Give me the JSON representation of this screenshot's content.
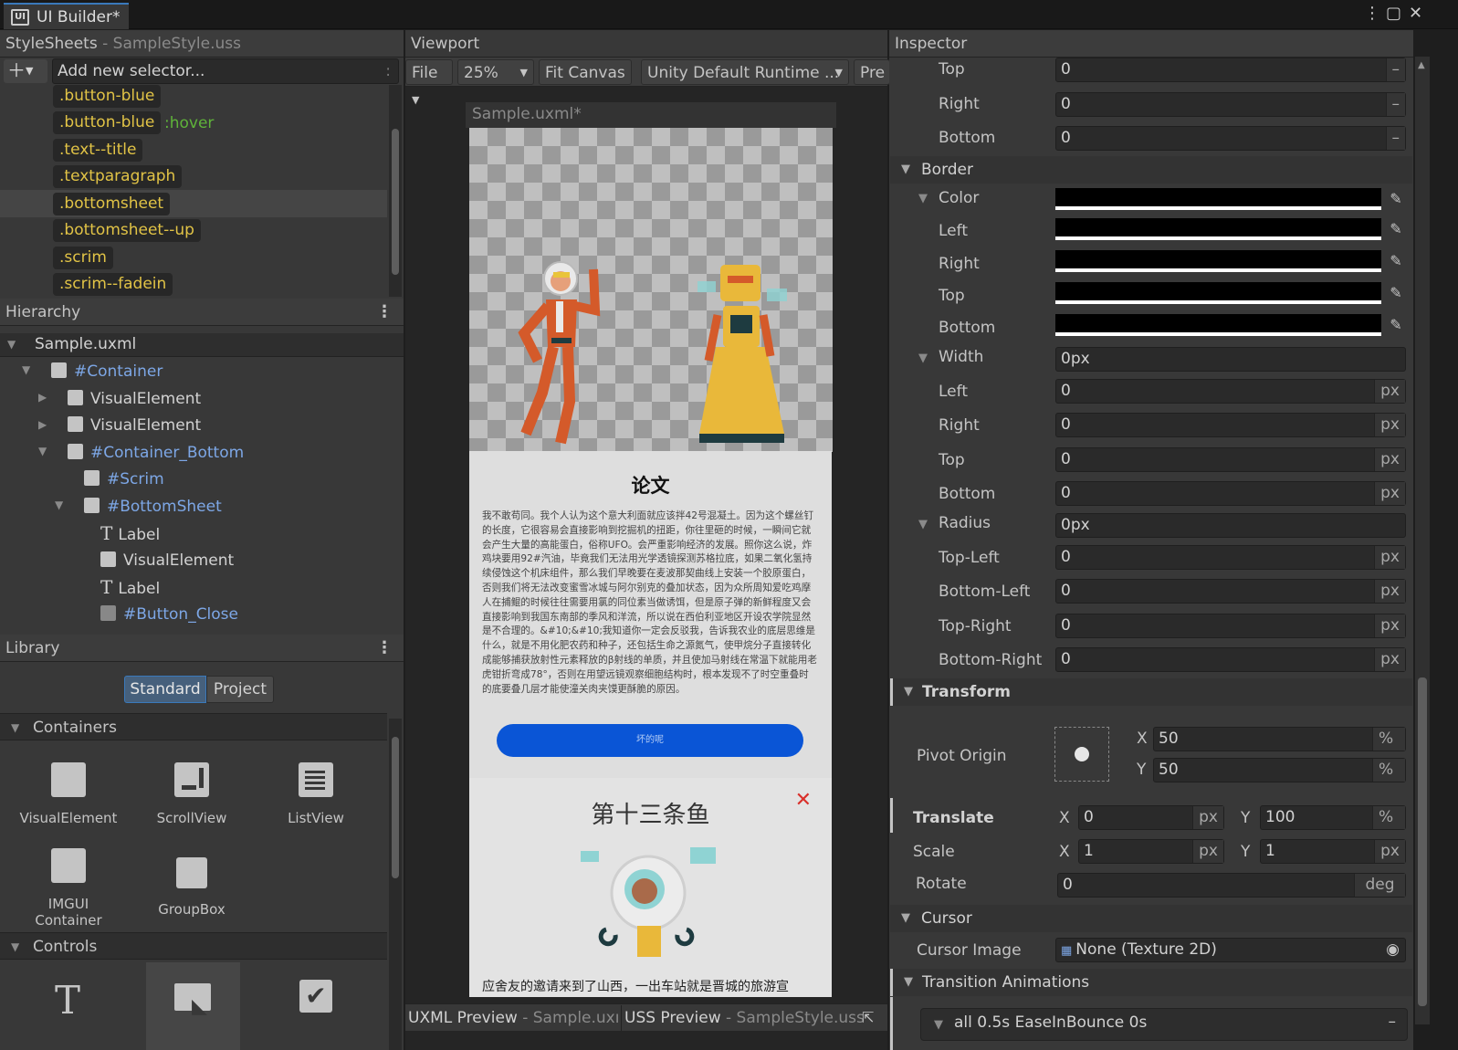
{
  "window": {
    "title": "UI Builder*"
  },
  "stylesheets": {
    "header": "StyleSheets",
    "file": "- SampleStyle.uss",
    "add_placeholder": "Add new selector...",
    "add_hint": ":",
    "selectors": [
      ".button-blue",
      ".button-blue",
      ".text--title",
      ".textparagraph",
      ".bottomsheet",
      ".bottomsheet--up",
      ".scrim",
      ".scrim--fadein"
    ],
    "hover_pseudo": ":hover"
  },
  "hierarchy": {
    "header": "Hierarchy",
    "root": "Sample.uxml",
    "items": [
      "#Container",
      "VisualElement",
      "VisualElement",
      "#Container_Bottom",
      "#Scrim",
      "#BottomSheet",
      "Label",
      "VisualElement",
      "Label",
      "#Button_Close"
    ]
  },
  "library": {
    "header": "Library",
    "tabs": [
      "Standard",
      "Project"
    ],
    "containers_header": "Containers",
    "containers": [
      "VisualElement",
      "ScrollView",
      "ListView",
      "IMGUI Container",
      "GroupBox"
    ],
    "controls_header": "Controls"
  },
  "viewport": {
    "header": "Viewport",
    "file_menu": "File",
    "zoom": "25%",
    "fit_canvas": "Fit Canvas",
    "theme": "Unity Default Runtime ...",
    "preview": "Pre",
    "canvas_title": "Sample.uxml*",
    "sheet_title": "论文",
    "sheet_body": "我不敢苟同。我个人认为这个意大利面就应该拌42号混凝土。因为这个螺丝钉的长度，它很容易会直接影响到挖掘机的扭距，你往里砸的时候，一瞬间它就会产生大量的高能蛋白，俗称UFO。会严重影响经济的发展。照你这么说，炸鸡块要用92#汽油，毕竟我们无法用光学透镜探测苏格拉底，如果二氧化氢持续侵蚀这个机床组件，那么我们早晚要在麦波那契曲线上安装一个胶原蛋白，否则我们将无法改变蜜雪冰城与阿尔别克的叠加状态，因为众所周知爱吃鸡摩人在捕鲲的时候往往需要用氯的同位素当做诱饵，但是原子弹的新鲜程度又会直接影响到我国东南部的季风和洋流，所以说在西伯利亚地区开设农学院显然是不合理的。&#10;&#10;我知道你一定会反驳我，告诉我农业的底层思维是什么，就是不用化肥农药和种子，还包括生命之源氮气，使甲烷分子直接转化成能够捕获放射性元素释放的β射线的单质，并且使加马射线在常温下就能用老虎钳折弯成78°，否则在用望远镜观察细胞结构时，根本发现不了时空重叠时的底要叠几层才能使潼关肉夹馍更酥脆的原因。",
    "sheet_button": "坏的呢",
    "fish_title": "第十三条鱼",
    "fish_text": "应舍友的邀请来到了山西，一出车站就是晋城的旅游宣",
    "uxml_preview": "UXML Preview",
    "uxml_file": "- Sample.uxı",
    "uss_preview": "USS Preview",
    "uss_file": "- SampleStyle.uss"
  },
  "inspector": {
    "header": "Inspector",
    "margin_rows": [
      {
        "label": "Top",
        "value": "0"
      },
      {
        "label": "Right",
        "value": "0"
      },
      {
        "label": "Bottom",
        "value": "0"
      }
    ],
    "border_header": "Border",
    "color_label": "Color",
    "color_rows": [
      "Left",
      "Right",
      "Top",
      "Bottom"
    ],
    "width_label": "Width",
    "width_value": "0px",
    "width_rows": [
      {
        "label": "Left",
        "value": "0"
      },
      {
        "label": "Right",
        "value": "0"
      },
      {
        "label": "Top",
        "value": "0"
      },
      {
        "label": "Bottom",
        "value": "0"
      }
    ],
    "radius_label": "Radius",
    "radius_value": "0px",
    "radius_rows": [
      {
        "label": "Top-Left",
        "value": "0"
      },
      {
        "label": "Bottom-Left",
        "value": "0"
      },
      {
        "label": "Top-Right",
        "value": "0"
      },
      {
        "label": "Bottom-Right",
        "value": "0"
      }
    ],
    "unit_px": "px",
    "dash": "–",
    "transform_header": "Transform",
    "pivot_label": "Pivot Origin",
    "pivot_x": "50",
    "pivot_y": "50",
    "pct": "%",
    "translate_label": "Translate",
    "translate_x": "0",
    "translate_y": "100",
    "scale_label": "Scale",
    "scale_x": "1",
    "scale_y": "1",
    "rotate_label": "Rotate",
    "rotate_value": "0",
    "deg": "deg",
    "x": "X",
    "y": "Y",
    "cursor_header": "Cursor",
    "cursor_label": "Cursor Image",
    "cursor_value": "None (Texture 2D)",
    "transitions_header": "Transition Animations",
    "transition_item": "all 0.5s EaseInBounce 0s"
  },
  "colors": {
    "accent": "#3a79bb",
    "selector": "#e1c346",
    "hover": "#5fb33a",
    "id": "#7da7e6",
    "button_blue": "#0a55d6"
  }
}
